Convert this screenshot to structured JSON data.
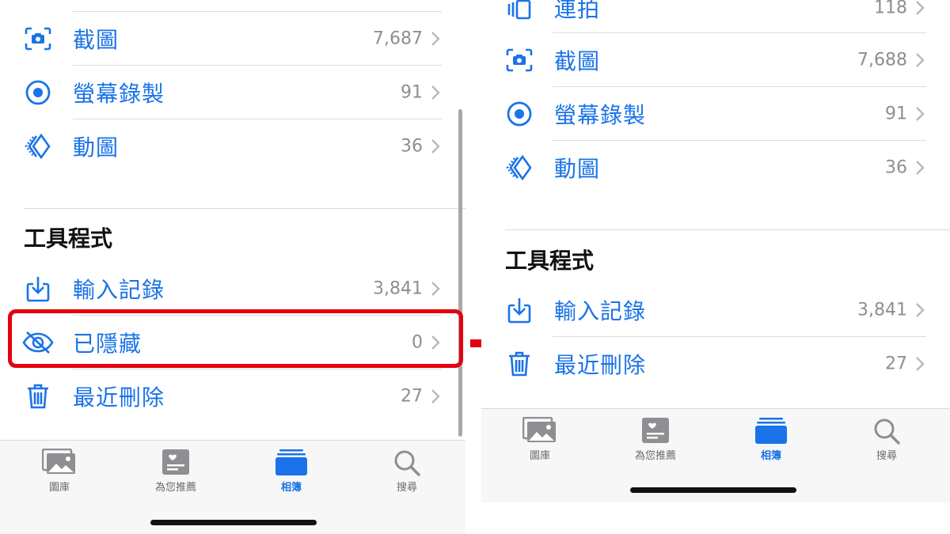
{
  "colors": {
    "accent": "#1a73e8",
    "highlight": "#e3000f",
    "arrow": "#e3000f"
  },
  "left": {
    "rows": [
      {
        "icon": "screenshot-icon",
        "label": "截圖",
        "count": "7,687"
      },
      {
        "icon": "screen-recording-icon",
        "label": "螢幕錄製",
        "count": "91"
      },
      {
        "icon": "animated-icon",
        "label": "動圖",
        "count": "36"
      }
    ],
    "section_title": "工具程式",
    "utility_rows": [
      {
        "icon": "import-icon",
        "label": "輸入記錄",
        "count": "3,841"
      },
      {
        "icon": "hidden-eye-icon",
        "label": "已隱藏",
        "count": "0"
      },
      {
        "icon": "trash-icon",
        "label": "最近刪除",
        "count": "27"
      }
    ]
  },
  "right": {
    "rows": [
      {
        "icon": "burst-icon",
        "label": "連拍",
        "count": "118"
      },
      {
        "icon": "screenshot-icon",
        "label": "截圖",
        "count": "7,688"
      },
      {
        "icon": "screen-recording-icon",
        "label": "螢幕錄製",
        "count": "91"
      },
      {
        "icon": "animated-icon",
        "label": "動圖",
        "count": "36"
      }
    ],
    "section_title": "工具程式",
    "utility_rows": [
      {
        "icon": "import-icon",
        "label": "輸入記錄",
        "count": "3,841"
      },
      {
        "icon": "trash-icon",
        "label": "最近刪除",
        "count": "27"
      }
    ]
  },
  "tabbar": {
    "tabs": [
      {
        "icon": "library-icon",
        "label": "圖庫"
      },
      {
        "icon": "for-you-icon",
        "label": "為您推薦"
      },
      {
        "icon": "albums-icon",
        "label": "相簿",
        "active": true
      },
      {
        "icon": "search-icon",
        "label": "搜尋"
      }
    ]
  }
}
